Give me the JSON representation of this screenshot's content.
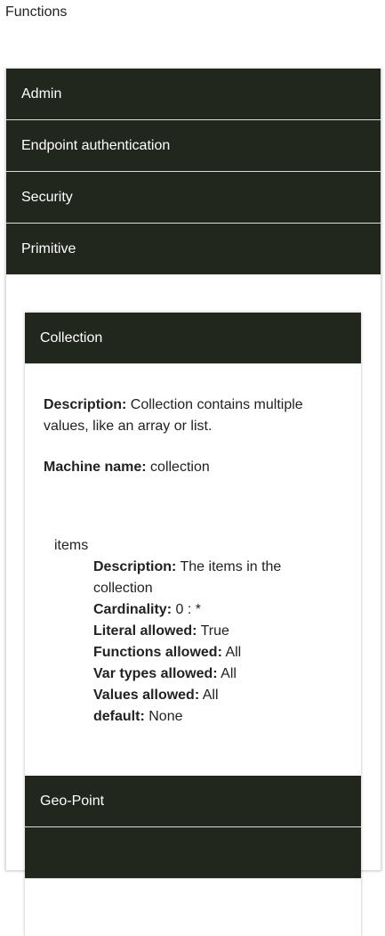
{
  "page_title": "Functions",
  "sections": [
    "Admin",
    "Endpoint authentication",
    "Security",
    "Primitive"
  ],
  "collection": {
    "title": "Collection",
    "description_label": "Description:",
    "description": "Collection contains multiple values, like an array or list.",
    "machine_name_label": "Machine name:",
    "machine_name": "collection",
    "item": {
      "name": "items",
      "props": [
        {
          "label": "Description:",
          "value": "The items in the collection"
        },
        {
          "label": "Cardinality:",
          "value": "0 : *"
        },
        {
          "label": "Literal allowed:",
          "value": "True"
        },
        {
          "label": "Functions allowed:",
          "value": "All"
        },
        {
          "label": "Var types allowed:",
          "value": "All"
        },
        {
          "label": "Values allowed:",
          "value": "All"
        },
        {
          "label": "default:",
          "value": "None"
        }
      ]
    }
  },
  "next_item": "Geo-Point",
  "colors": {
    "header_bg": "#22271e",
    "header_text": "#ffffff"
  }
}
